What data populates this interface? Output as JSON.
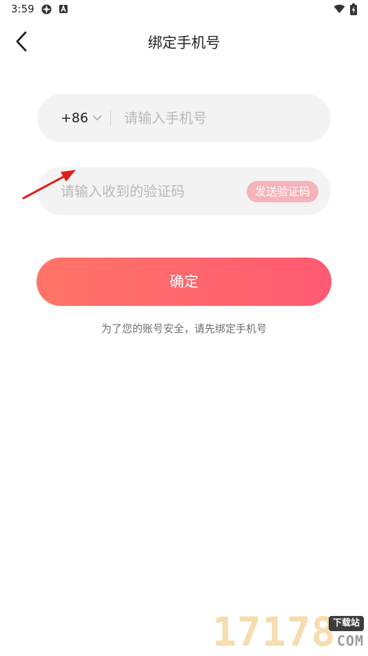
{
  "status_bar": {
    "time": "3:59",
    "icons": [
      "app-notification-icon",
      "a-letter-icon",
      "wifi-icon",
      "battery-charging-icon"
    ]
  },
  "header": {
    "title": "绑定手机号",
    "back_icon": "chevron-left-icon"
  },
  "form": {
    "country_code": "+86",
    "phone_placeholder": "请输入手机号",
    "phone_value": "",
    "code_placeholder": "请输入收到的验证码",
    "code_value": "",
    "send_code_label": "发送验证码"
  },
  "confirm_label": "确定",
  "hint": "为了您的账号安全，请先绑定手机号",
  "watermark": {
    "digits": "17178",
    "badge": "下载站",
    "domain": "COM"
  },
  "colors": {
    "gradient_start": "#ff7467",
    "gradient_end": "#ff5a72",
    "send_code_bg": "#f7b3ba",
    "field_bg": "#f3f3f3",
    "annotation_arrow": "#d9201a"
  }
}
